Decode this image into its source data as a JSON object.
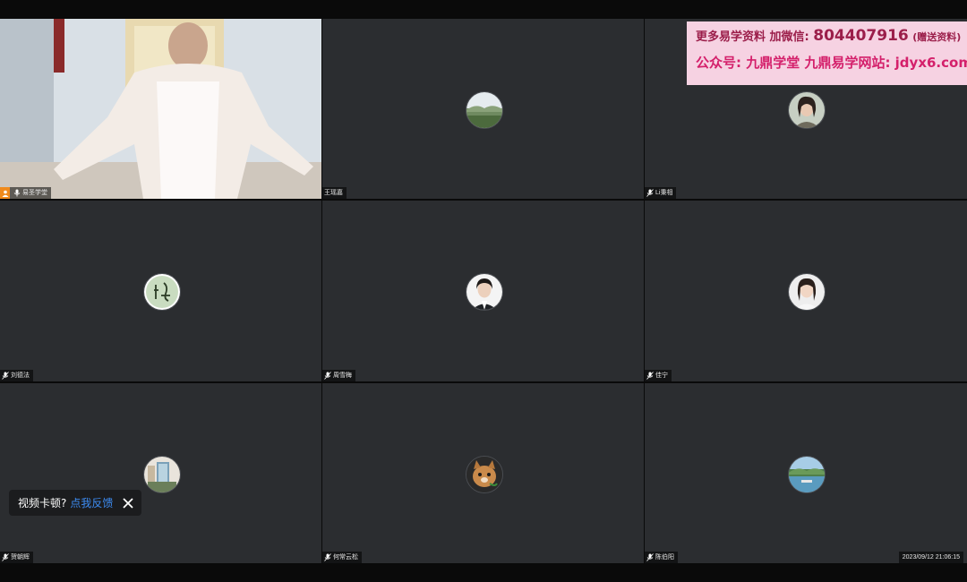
{
  "participants": [
    {
      "name": "易圣学堂",
      "mic": "on",
      "host": true,
      "video": true
    },
    {
      "name": "王瑶嘉",
      "mic": "none",
      "host": false,
      "avatar": "landscape-avatar"
    },
    {
      "name": "Li秉相",
      "mic": "muted",
      "host": false,
      "avatar": "woman-avatar"
    },
    {
      "name": "刘德法",
      "mic": "muted",
      "host": false,
      "avatar": "calligraphy-avatar"
    },
    {
      "name": "周雪梅",
      "mic": "muted",
      "host": false,
      "avatar": "portrait-avatar"
    },
    {
      "name": "佳宁",
      "mic": "muted",
      "host": false,
      "avatar": "woman-avatar-2"
    },
    {
      "name": "贺朝辉",
      "mic": "muted",
      "host": false,
      "avatar": "room-avatar"
    },
    {
      "name": "何常云松",
      "mic": "muted",
      "host": false,
      "avatar": "cat-avatar"
    },
    {
      "name": "陈伯阳",
      "mic": "muted",
      "host": false,
      "avatar": "lake-avatar"
    }
  ],
  "promo": {
    "line1_prefix": "更多易学资料 加微信:",
    "line1_number": "804407916",
    "line1_suffix": "(赠送资料)",
    "line2": "公众号: 九鼎学堂 九鼎易学网站: jdyx6.com"
  },
  "feedback_toast": {
    "question": "视频卡顿?",
    "link": "点我反馈"
  },
  "timestamp": "2023/09/12 21:06:15",
  "colors": {
    "tile_bg": "#2b2d30",
    "host_badge": "#f08a1c",
    "link": "#3d8cf2",
    "promo_bg": "#f6d2e2"
  }
}
